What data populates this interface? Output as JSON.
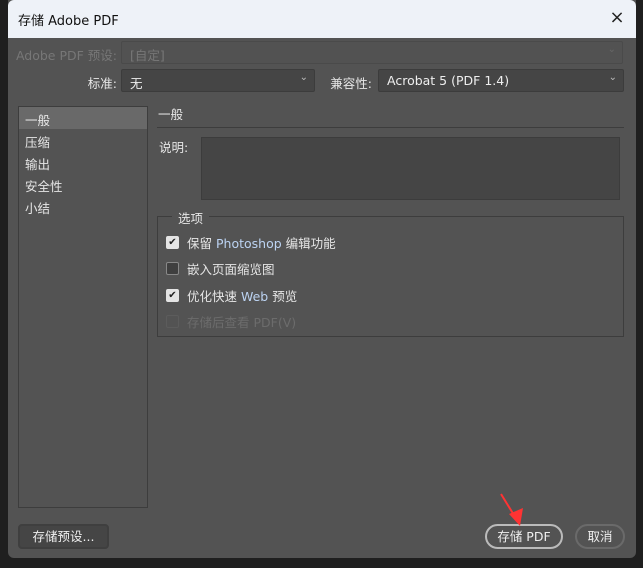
{
  "window": {
    "title": "存储 Adobe PDF",
    "close_icon": "×"
  },
  "preset": {
    "label": "Adobe PDF 预设:",
    "value": "[自定]"
  },
  "standard": {
    "label": "标准:",
    "value": "无"
  },
  "compat": {
    "label": "兼容性:",
    "value": "Acrobat 5 (PDF 1.4)"
  },
  "sidebar": {
    "items": [
      {
        "label": "一般"
      },
      {
        "label": "压缩"
      },
      {
        "label": "输出"
      },
      {
        "label": "安全性"
      },
      {
        "label": "小结"
      }
    ]
  },
  "main": {
    "section_title": "一般",
    "description_label": "说明:",
    "description_value": "",
    "options": {
      "legend": "选项",
      "items": [
        {
          "pre": "保留 ",
          "hl": "Photoshop",
          "post": " 编辑功能",
          "checked": true,
          "disabled": false
        },
        {
          "pre": "嵌入页面缩览图",
          "hl": "",
          "post": "",
          "checked": false,
          "disabled": false
        },
        {
          "pre": "优化快速 ",
          "hl": "Web",
          "post": " 预览",
          "checked": true,
          "disabled": false
        },
        {
          "pre": "存储后查看 PDF(V)",
          "hl": "",
          "post": "",
          "checked": false,
          "disabled": true
        }
      ]
    }
  },
  "buttons": {
    "save_preset": "存储预设...",
    "save_pdf": "存储 PDF",
    "cancel": "取消"
  },
  "colors": {
    "annotation_arrow": "#ff3333"
  }
}
